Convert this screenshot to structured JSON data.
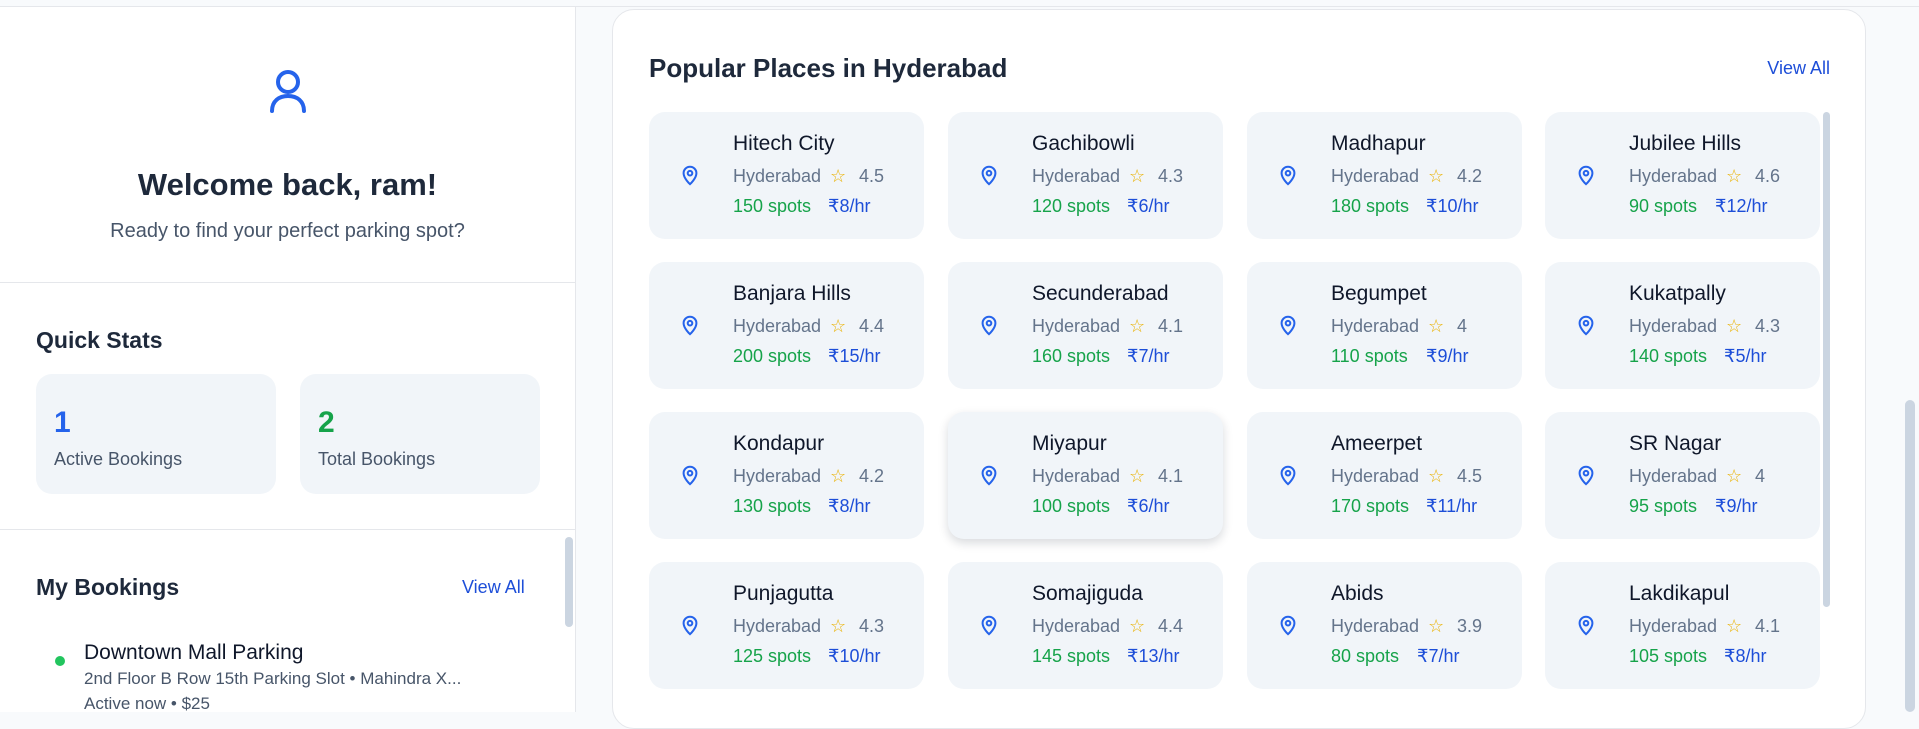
{
  "welcome": {
    "title": "Welcome back, ram!",
    "subtitle": "Ready to find your perfect parking spot?"
  },
  "quick_stats": {
    "title": "Quick Stats",
    "cards": [
      {
        "value": "1",
        "label": "Active Bookings"
      },
      {
        "value": "2",
        "label": "Total Bookings"
      }
    ]
  },
  "my_bookings": {
    "title": "My Bookings",
    "view_all": "View All",
    "items": [
      {
        "name": "Downtown Mall Parking",
        "detail": "2nd Floor B Row 15th Parking Slot • Mahindra X...",
        "status": "Active now • $25"
      }
    ]
  },
  "popular_places": {
    "title": "Popular Places in Hyderabad",
    "view_all": "View All",
    "places": [
      {
        "name": "Hitech City",
        "city": "Hyderabad",
        "rating": "4.5",
        "spots": "150 spots",
        "price": "₹8/hr"
      },
      {
        "name": "Gachibowli",
        "city": "Hyderabad",
        "rating": "4.3",
        "spots": "120 spots",
        "price": "₹6/hr"
      },
      {
        "name": "Madhapur",
        "city": "Hyderabad",
        "rating": "4.2",
        "spots": "180 spots",
        "price": "₹10/hr"
      },
      {
        "name": "Jubilee Hills",
        "city": "Hyderabad",
        "rating": "4.6",
        "spots": "90 spots",
        "price": "₹12/hr"
      },
      {
        "name": "Banjara Hills",
        "city": "Hyderabad",
        "rating": "4.4",
        "spots": "200 spots",
        "price": "₹15/hr"
      },
      {
        "name": "Secunderabad",
        "city": "Hyderabad",
        "rating": "4.1",
        "spots": "160 spots",
        "price": "₹7/hr"
      },
      {
        "name": "Begumpet",
        "city": "Hyderabad",
        "rating": "4",
        "spots": "110 spots",
        "price": "₹9/hr"
      },
      {
        "name": "Kukatpally",
        "city": "Hyderabad",
        "rating": "4.3",
        "spots": "140 spots",
        "price": "₹5/hr"
      },
      {
        "name": "Kondapur",
        "city": "Hyderabad",
        "rating": "4.2",
        "spots": "130 spots",
        "price": "₹8/hr"
      },
      {
        "name": "Miyapur",
        "city": "Hyderabad",
        "rating": "4.1",
        "spots": "100 spots",
        "price": "₹6/hr"
      },
      {
        "name": "Ameerpet",
        "city": "Hyderabad",
        "rating": "4.5",
        "spots": "170 spots",
        "price": "₹11/hr"
      },
      {
        "name": "SR Nagar",
        "city": "Hyderabad",
        "rating": "4",
        "spots": "95 spots",
        "price": "₹9/hr"
      },
      {
        "name": "Punjagutta",
        "city": "Hyderabad",
        "rating": "4.3",
        "spots": "125 spots",
        "price": "₹10/hr"
      },
      {
        "name": "Somajiguda",
        "city": "Hyderabad",
        "rating": "4.4",
        "spots": "145 spots",
        "price": "₹13/hr"
      },
      {
        "name": "Abids",
        "city": "Hyderabad",
        "rating": "3.9",
        "spots": "80 spots",
        "price": "₹7/hr"
      },
      {
        "name": "Lakdikapul",
        "city": "Hyderabad",
        "rating": "4.1",
        "spots": "105 spots",
        "price": "₹8/hr"
      }
    ]
  },
  "icons": {
    "user": "user-icon",
    "pin": "map-pin-icon",
    "star": "star-icon"
  },
  "colors": {
    "accent": "#2563eb",
    "success": "#16a34a",
    "star": "#eab308"
  }
}
